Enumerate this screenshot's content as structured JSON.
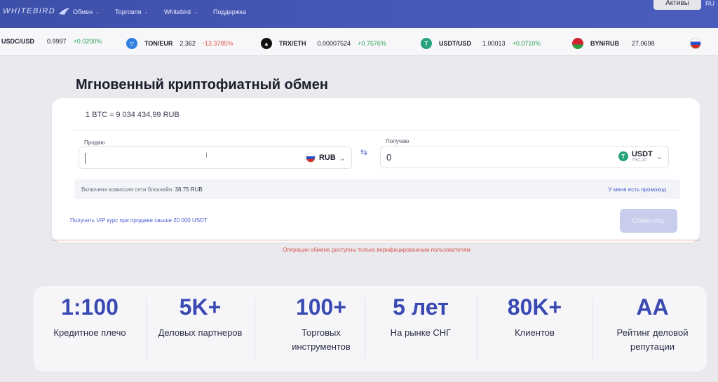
{
  "nav": {
    "logo": "WHITEBIRD",
    "items": [
      {
        "label": "Обмен"
      },
      {
        "label": "Торговля"
      },
      {
        "label": "Whitebird"
      },
      {
        "label": "Поддержка"
      }
    ],
    "assets_button": "Активы",
    "lang": "RU"
  },
  "ticker": [
    {
      "pair": "USDC/USD",
      "price": "0.9997",
      "change": "+0.0200%"
    },
    {
      "pair": "TON/EUR",
      "price": "2.362",
      "change": "-13.3785%"
    },
    {
      "pair": "TRX/ETH",
      "price": "0.00007524",
      "change": "+0.7576%"
    },
    {
      "pair": "USDT/USD",
      "price": "1.00013",
      "change": "+0.0710%"
    },
    {
      "pair": "BYN/RUB",
      "price": "27.0698",
      "change": ""
    }
  ],
  "exchange": {
    "title": "Мгновенный криптофиатный обмен",
    "rate": "1 BTC ≈ 9 034 434,99 RUB",
    "sell_label": "Продаю",
    "sell_value": "",
    "sell_currency": "RUB",
    "buy_label": "Получаю",
    "buy_value": "0",
    "buy_currency": "USDT",
    "buy_network": "TRC-20",
    "fee_text": "Включена комиссия сети блокчейн:",
    "fee_value": "38.75 RUB",
    "promo": "У меня есть промокод",
    "vip": "Получить VIP курс при продаже свыше 20 000 USDT",
    "exchange_button": "Обменять",
    "warning": "Операции обмена доступны только верифицированным пользователям"
  },
  "stats": [
    {
      "value": "1:100",
      "caption": "Кредитное плечо"
    },
    {
      "value": "5K+",
      "caption": "Деловых партнеров"
    },
    {
      "value": "100+",
      "caption": "Торговых инструментов"
    },
    {
      "value": "5 лет",
      "caption": "На рынке СНГ"
    },
    {
      "value": "80K+",
      "caption": "Клиентов"
    },
    {
      "value": "AA",
      "caption": "Рейтинг деловой репутации"
    }
  ],
  "colors": {
    "nav_bg": "#4658b6",
    "accent": "#3b4ab3",
    "positive": "#2fa35a",
    "negative": "#e2564a",
    "warning": "#d8574c"
  }
}
